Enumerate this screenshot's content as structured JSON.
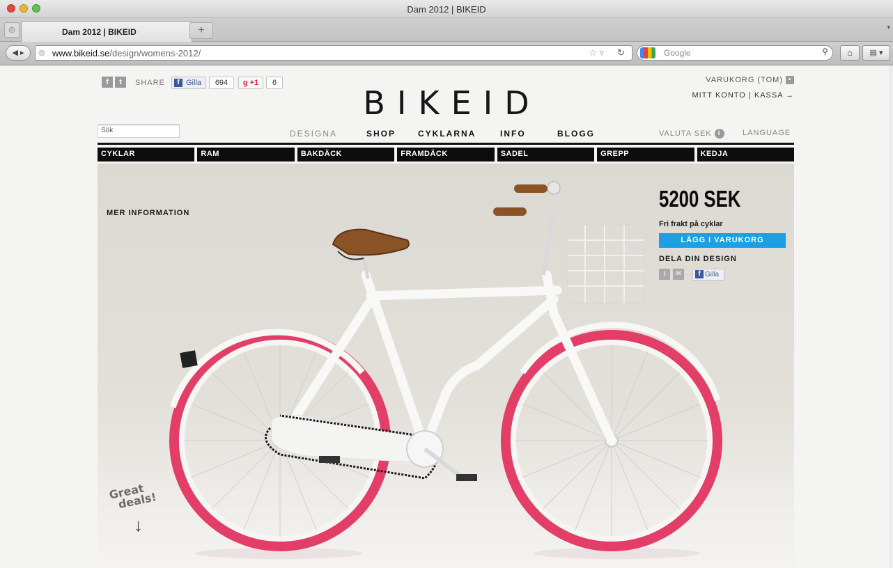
{
  "window": {
    "title": "Dam 2012 | BIKEID"
  },
  "tab": {
    "title": "Dam 2012 | BIKEID",
    "new_tab": "+"
  },
  "toolbar": {
    "url_domain": "www.bikeid.se",
    "url_path": "/design/womens-2012/",
    "search_placeholder": "Google"
  },
  "social": {
    "share_label": "SHARE",
    "gilla_label": "Gilla",
    "gilla_count": "694",
    "gplus_label": "+1",
    "gplus_count": "6"
  },
  "brand": {
    "logo": "BIKEID"
  },
  "account": {
    "cart": "VARUKORG (TOM)",
    "my_account": "MITT KONTO",
    "separator": "|",
    "checkout": "KASSA →"
  },
  "search": {
    "placeholder": "Sök"
  },
  "nav": {
    "items": [
      "DESIGNA",
      "SHOP",
      "CYKLARNA",
      "INFO",
      "BLOGG"
    ],
    "currency": "VALUTA SEK",
    "language": "LANGUAGE"
  },
  "categories": [
    "CYKLAR",
    "RAM",
    "BAKDÄCK",
    "FRAMDÄCK",
    "SADEL",
    "GREPP",
    "KEDJA"
  ],
  "product": {
    "more_info": "MER INFORMATION",
    "price": "5200 SEK",
    "free_shipping": "Fri frakt på cyklar",
    "add_to_cart": "LÄGG I VARUKORG",
    "share_design": "DELA DIN DESIGN",
    "gilla_label": "Gilla"
  },
  "promo": {
    "line1": "Great",
    "line2": "deals!"
  },
  "colors": {
    "accent_blue": "#1aa0e3",
    "tire_pink": "#e8406a",
    "frame_white": "#f8f8f6",
    "saddle_brown": "#8b5a2b",
    "hero_bg": "#dcd9d3"
  },
  "icons": {
    "facebook": "facebook-icon",
    "twitter": "twitter-icon",
    "info": "info-icon",
    "email": "email-icon",
    "reload": "reload-icon",
    "bookmark_star": "star-icon",
    "home": "home-icon",
    "search": "search-icon"
  }
}
